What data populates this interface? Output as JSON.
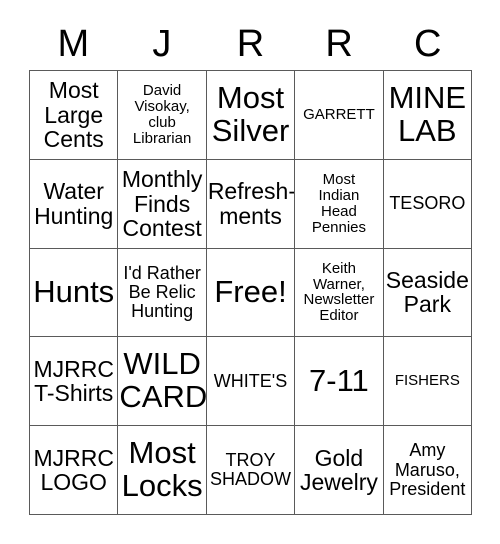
{
  "card": {
    "title_letters": [
      "M",
      "J",
      "R",
      "R",
      "C"
    ],
    "columns": 5,
    "rows": 5,
    "border_color": "#5a5a5a",
    "background": "#ffffff",
    "text_color": "#000000",
    "cells": [
      [
        {
          "text": "Most\nLarge\nCents",
          "size": "fs-md"
        },
        {
          "text": "David\nVisokay,\nclub\nLibrarian",
          "size": "fs-xs"
        },
        {
          "text": "Most\nSilver",
          "size": "fs-xl"
        },
        {
          "text": "GARRETT",
          "size": "fs-xs"
        },
        {
          "text": "MINE\nLAB",
          "size": "fs-xl"
        }
      ],
      [
        {
          "text": "Water\nHunting",
          "size": "fs-md"
        },
        {
          "text": "Monthly\nFinds\nContest",
          "size": "fs-md"
        },
        {
          "text": "Refresh-\nments",
          "size": "fs-md"
        },
        {
          "text": "Most\nIndian\nHead\nPennies",
          "size": "fs-xs"
        },
        {
          "text": "TESORO",
          "size": "fs-sm"
        }
      ],
      [
        {
          "text": "Hunts",
          "size": "fs-xl"
        },
        {
          "text": "I'd Rather\nBe Relic\nHunting",
          "size": "fs-sm"
        },
        {
          "text": "Free!",
          "size": "fs-xl"
        },
        {
          "text": "Keith\nWarner,\nNewsletter\nEditor",
          "size": "fs-xs"
        },
        {
          "text": "Seaside\nPark",
          "size": "fs-md"
        }
      ],
      [
        {
          "text": "MJRRC\nT-Shirts",
          "size": "fs-md"
        },
        {
          "text": "WILD\nCARD",
          "size": "fs-xl"
        },
        {
          "text": "WHITE'S",
          "size": "fs-sm"
        },
        {
          "text": "7-11",
          "size": "fs-xl"
        },
        {
          "text": "FISHERS",
          "size": "fs-xs"
        }
      ],
      [
        {
          "text": "MJRRC\nLOGO",
          "size": "fs-md"
        },
        {
          "text": "Most\nLocks",
          "size": "fs-xl"
        },
        {
          "text": "TROY\nSHADOW",
          "size": "fs-sm"
        },
        {
          "text": "Gold\nJewelry",
          "size": "fs-md"
        },
        {
          "text": "Amy\nMaruso,\nPresident",
          "size": "fs-sm"
        }
      ]
    ]
  }
}
